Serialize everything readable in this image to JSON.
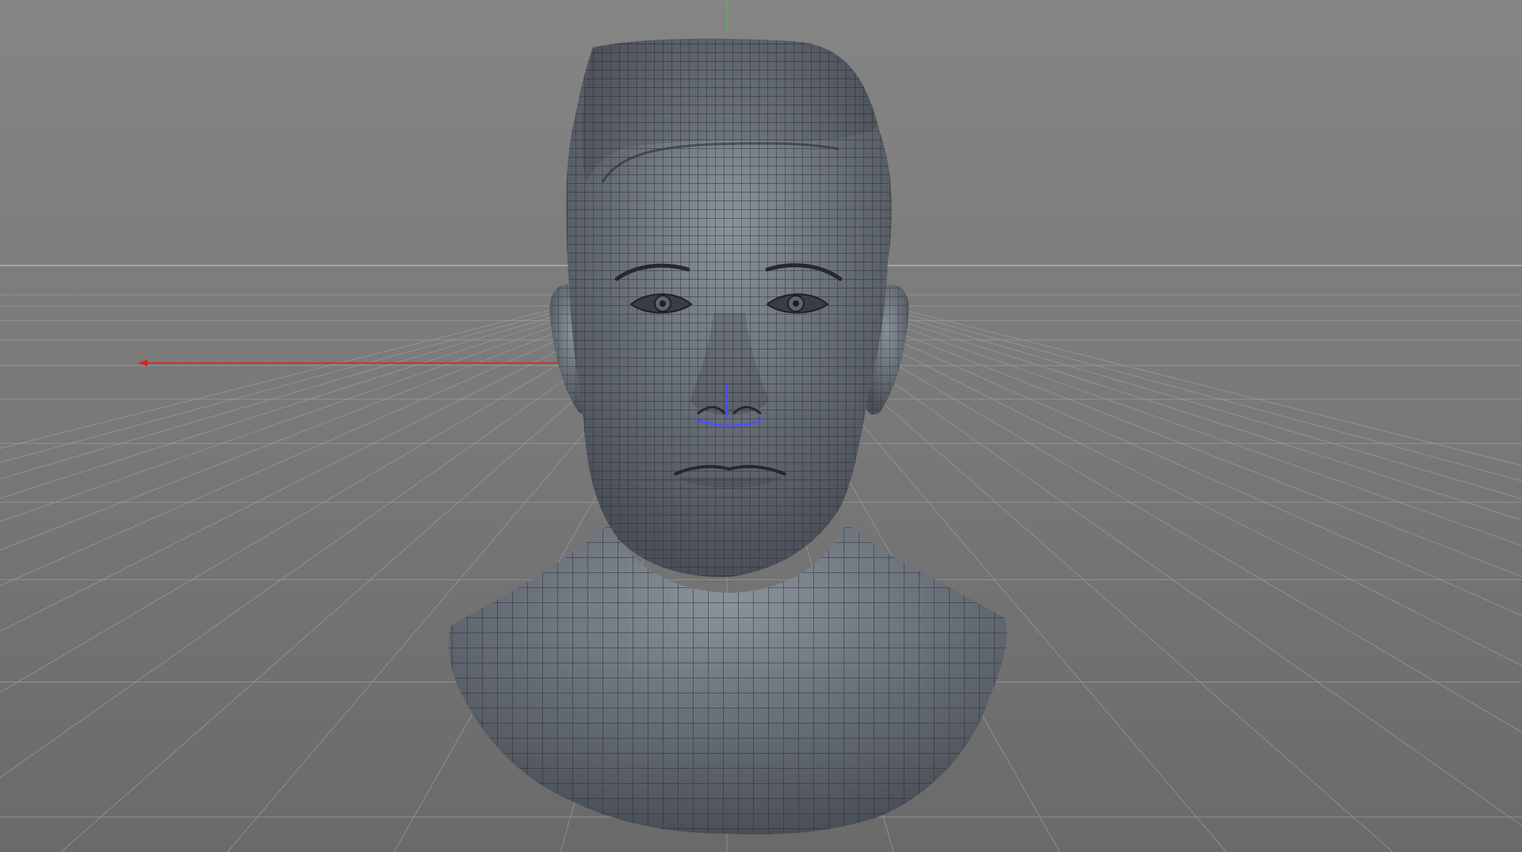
{
  "viewport": {
    "view_type": "perspective",
    "display_mode": "shaded-with-wireframe",
    "grid_visible": true,
    "world_axes_visible": true,
    "selection_highlight_visible": true
  },
  "colors": {
    "background_top": "#858585",
    "background_mid": "#7a7a7a",
    "background_bottom": "#6a6a6a",
    "grid_line": "#9a9a9a",
    "horizon_line": "#b4b4b4",
    "x_axis": "#e02020",
    "y_axis": "#3fbf5a",
    "mesh_fill_light": "#8a929c",
    "mesh_fill_dark": "#4a4f57",
    "mesh_wire": "#2a2d31",
    "selection": "#4d4dff"
  },
  "model": {
    "kind": "human head bust",
    "icon": "polygon-mesh-icon"
  }
}
